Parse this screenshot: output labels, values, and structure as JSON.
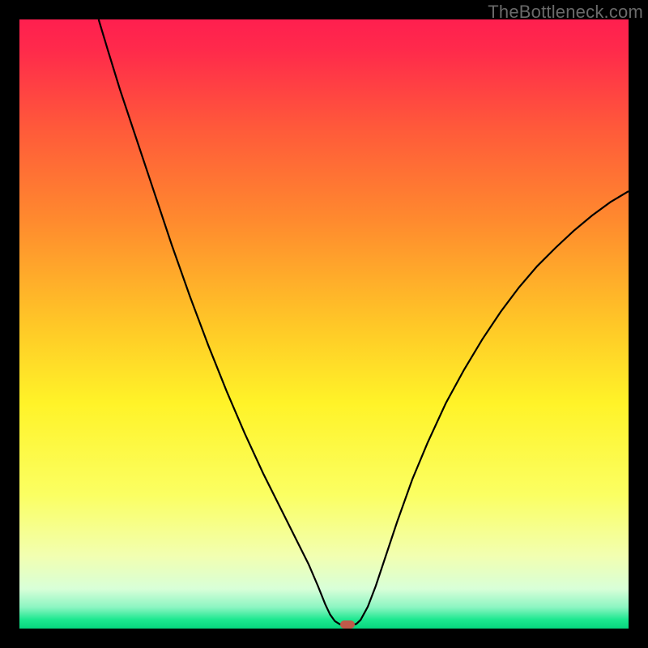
{
  "watermark": {
    "text": "TheBottleneck.com"
  },
  "chart_data": {
    "type": "line",
    "title": "",
    "xlabel": "",
    "ylabel": "",
    "xlim": [
      0,
      100
    ],
    "ylim": [
      0,
      100
    ],
    "background_gradient": {
      "stops": [
        {
          "offset": 0.0,
          "color": "#ff1f4f"
        },
        {
          "offset": 0.05,
          "color": "#ff2a4b"
        },
        {
          "offset": 0.18,
          "color": "#ff5a3a"
        },
        {
          "offset": 0.33,
          "color": "#ff8a2e"
        },
        {
          "offset": 0.5,
          "color": "#ffc727"
        },
        {
          "offset": 0.63,
          "color": "#fff328"
        },
        {
          "offset": 0.78,
          "color": "#fbff62"
        },
        {
          "offset": 0.88,
          "color": "#f2ffb0"
        },
        {
          "offset": 0.935,
          "color": "#d8ffd8"
        },
        {
          "offset": 0.965,
          "color": "#8cf5c2"
        },
        {
          "offset": 0.985,
          "color": "#1ee890"
        },
        {
          "offset": 1.0,
          "color": "#06d67e"
        }
      ]
    },
    "series": [
      {
        "name": "bottleneck-curve",
        "color": "#000000",
        "width": 2.2,
        "points": [
          [
            13.0,
            100.0
          ],
          [
            14.5,
            95.0
          ],
          [
            16.5,
            88.5
          ],
          [
            19.0,
            81.0
          ],
          [
            22.0,
            72.0
          ],
          [
            25.0,
            63.0
          ],
          [
            28.0,
            54.5
          ],
          [
            31.0,
            46.5
          ],
          [
            34.0,
            39.0
          ],
          [
            37.0,
            32.0
          ],
          [
            40.0,
            25.5
          ],
          [
            43.0,
            19.5
          ],
          [
            45.5,
            14.5
          ],
          [
            47.5,
            10.5
          ],
          [
            49.0,
            7.0
          ],
          [
            50.2,
            4.0
          ],
          [
            51.0,
            2.3
          ],
          [
            51.8,
            1.2
          ],
          [
            52.6,
            0.7
          ],
          [
            53.6,
            0.6
          ],
          [
            54.6,
            0.6
          ],
          [
            55.3,
            0.75
          ],
          [
            56.0,
            1.4
          ],
          [
            57.2,
            3.6
          ],
          [
            58.5,
            7.0
          ],
          [
            60.0,
            11.5
          ],
          [
            62.0,
            17.5
          ],
          [
            64.5,
            24.5
          ],
          [
            67.0,
            30.5
          ],
          [
            70.0,
            37.0
          ],
          [
            73.0,
            42.5
          ],
          [
            76.0,
            47.5
          ],
          [
            79.0,
            52.0
          ],
          [
            82.0,
            56.0
          ],
          [
            85.0,
            59.5
          ],
          [
            88.0,
            62.5
          ],
          [
            91.0,
            65.3
          ],
          [
            94.0,
            67.8
          ],
          [
            97.0,
            70.0
          ],
          [
            100.0,
            71.8
          ]
        ]
      }
    ],
    "markers": [
      {
        "name": "optimal-point",
        "x": 53.8,
        "y": 0.6,
        "color": "#c05a4a"
      }
    ]
  }
}
